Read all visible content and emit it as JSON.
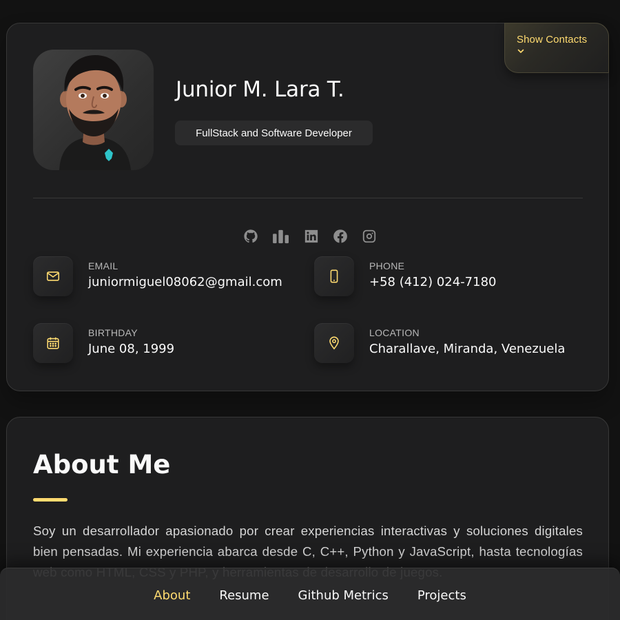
{
  "profile": {
    "name": "Junior M. Lara T.",
    "title": "FullStack and Software Developer",
    "show_contacts_label": "Show Contacts"
  },
  "social": [
    {
      "icon": "github-icon"
    },
    {
      "icon": "bar-chart-icon"
    },
    {
      "icon": "linkedin-icon"
    },
    {
      "icon": "facebook-icon"
    },
    {
      "icon": "instagram-icon"
    }
  ],
  "contacts": {
    "email": {
      "label": "EMAIL",
      "value": "juniormiguel08062@gmail.com",
      "icon": "mail-icon"
    },
    "phone": {
      "label": "PHONE",
      "value": "+58 (412) 024-7180",
      "icon": "phone-icon"
    },
    "birthday": {
      "label": "BIRTHDAY",
      "value": "June 08, 1999",
      "icon": "calendar-icon"
    },
    "location": {
      "label": "LOCATION",
      "value": "Charallave, Miranda, Venezuela",
      "icon": "location-pin-icon"
    }
  },
  "about": {
    "heading": "About Me",
    "paragraph": "Soy un desarrollador apasionado por crear experiencias interactivas y soluciones digitales bien pensadas. Mi experiencia abarca desde C, C++, Python y JavaScript, hasta tecnologías web como HTML, CSS y PHP, y herramientas de desarrollo de juegos."
  },
  "nav": {
    "items": [
      "About",
      "Resume",
      "Github Metrics",
      "Projects"
    ],
    "active": "About"
  },
  "colors": {
    "accent": "#ffdb70",
    "background": "#121212",
    "card": "#1e1e1f"
  }
}
